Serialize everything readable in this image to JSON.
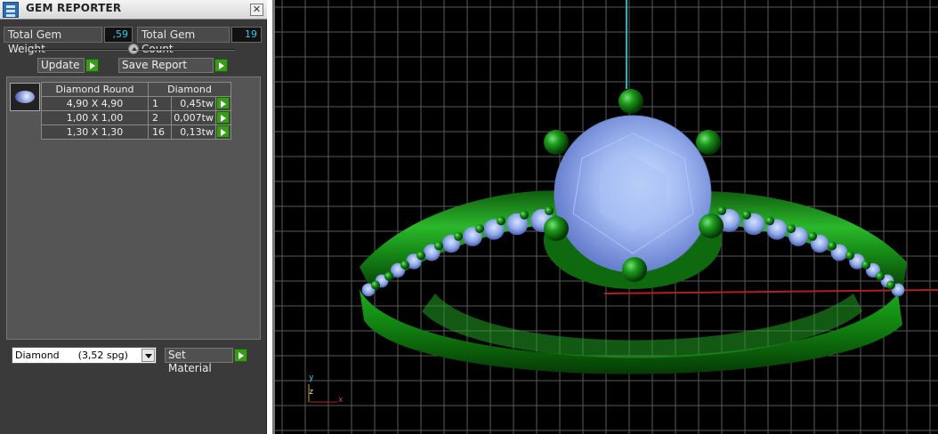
{
  "window": {
    "title": "GEM REPORTER",
    "close_glyph": "✕"
  },
  "summary": {
    "total_weight_label": "Total Gem Weight",
    "total_weight_value": ",59",
    "total_count_label": "Total Gem Count",
    "total_count_value": "19"
  },
  "actions": {
    "update_label": "Update",
    "save_report_label": "Save Report"
  },
  "table": {
    "headers": [
      "Diamond Round",
      "Diamond"
    ],
    "rows": [
      {
        "size": "4,90 X 4,90",
        "count": "1",
        "weight": "0,45tw"
      },
      {
        "size": "1,00 X 1,00",
        "count": "2",
        "weight": "0,007tw"
      },
      {
        "size": "1,30 X 1,30",
        "count": "16",
        "weight": "0,13tw"
      }
    ]
  },
  "material": {
    "selected": "Diamond      (3,52 spg)",
    "set_label": "Set Material"
  },
  "viewport": {
    "axis_labels": {
      "y": "y",
      "z": "z",
      "x": "x"
    },
    "colors": {
      "metal": "#1a8c1a",
      "gem": "#9db6f0",
      "grid": "#5a5a5a"
    }
  }
}
